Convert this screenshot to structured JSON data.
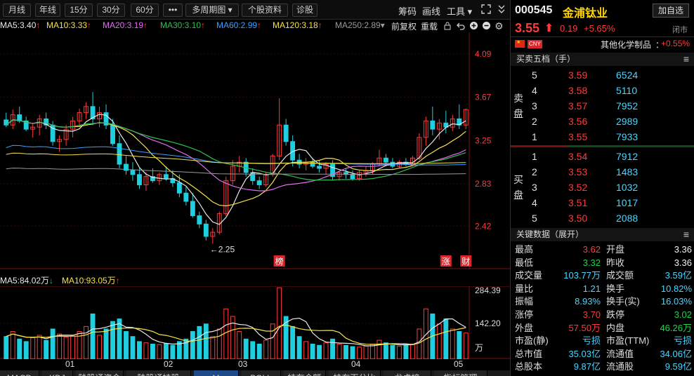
{
  "toolbar": {
    "periods": [
      "月线",
      "年线",
      "15分",
      "30分",
      "60分",
      "•••",
      "多周期图 ▾",
      "个股资料",
      "诊股"
    ],
    "right_links": [
      "筹码",
      "画线",
      "工具 ▾"
    ]
  },
  "ma_line": {
    "items": [
      {
        "text": "MA5:3.40",
        "arrow": "↑",
        "color": "#e8e8e8"
      },
      {
        "text": "MA10:3.33",
        "arrow": "↑",
        "color": "#f5e14b"
      },
      {
        "text": "MA20:3.19",
        "arrow": "↑",
        "color": "#e06cf2"
      },
      {
        "text": "MA30:3.10",
        "arrow": "↑",
        "color": "#2fbf4f"
      },
      {
        "text": "MA60:2.99",
        "arrow": "↑",
        "color": "#3aa0ff"
      },
      {
        "text": "MA120:3.18",
        "arrow": "↑",
        "color": "#f5e14b"
      },
      {
        "text": "MA250:2.89",
        "arrow": "▾",
        "color": "#9a9a9a"
      }
    ],
    "right": [
      "前复权",
      "重载"
    ]
  },
  "kchart": {
    "y_ticks": [
      "4.09",
      "3.67",
      "3.25",
      "2.83",
      "2.42"
    ],
    "low_label": "←2.25",
    "markers": [
      "榜",
      "涨",
      "财"
    ]
  },
  "volume": {
    "header": [
      {
        "text": "MA5:84.02万",
        "arrow": "↓",
        "color": "#e8e8e8"
      },
      {
        "text": "MA10:93.05万",
        "arrow": "↑",
        "color": "#f5e14b"
      }
    ],
    "y_ticks": [
      "284.39",
      "142.20",
      "万"
    ]
  },
  "xaxis": [
    "01",
    "02",
    "03",
    "04",
    "05"
  ],
  "bottom_tabs": [
    "MACD",
    "KDJ",
    "陆股通资金",
    "陆股通持股",
    "M",
    "BOLL",
    "持有金额",
    "持有百分比",
    "龙虎榜",
    "指标管理"
  ],
  "stock": {
    "code": "000545",
    "name": "金浦钛业",
    "add_button": "加自选",
    "price": "3.55",
    "change": "0.19",
    "change_pct": "+5.65%",
    "status": "闭市",
    "currency": "CNY",
    "sector": "其他化学制品",
    "sector_change": "+0.55%"
  },
  "order_book": {
    "title": "买卖五档（手）",
    "sell_label": [
      "卖",
      "盘"
    ],
    "buy_label": [
      "买",
      "盘"
    ],
    "sell": [
      {
        "level": "5",
        "price": "3.59",
        "vol": "6524"
      },
      {
        "level": "4",
        "price": "3.58",
        "vol": "5110"
      },
      {
        "level": "3",
        "price": "3.57",
        "vol": "7952"
      },
      {
        "level": "2",
        "price": "3.56",
        "vol": "2989"
      },
      {
        "level": "1",
        "price": "3.55",
        "vol": "7933"
      }
    ],
    "buy": [
      {
        "level": "1",
        "price": "3.54",
        "vol": "7912"
      },
      {
        "level": "2",
        "price": "3.53",
        "vol": "1483"
      },
      {
        "level": "3",
        "price": "3.52",
        "vol": "1032"
      },
      {
        "level": "4",
        "price": "3.51",
        "vol": "1017"
      },
      {
        "level": "5",
        "price": "3.50",
        "vol": "2088"
      }
    ]
  },
  "key_data": {
    "title": "关键数据（展开）",
    "rows": [
      {
        "l1": "最高",
        "v1": "3.62",
        "c1": "red",
        "l2": "开盘",
        "v2": "3.36",
        "c2": "white"
      },
      {
        "l1": "最低",
        "v1": "3.32",
        "c1": "green",
        "l2": "昨收",
        "v2": "3.36",
        "c2": "white"
      },
      {
        "l1": "成交量",
        "v1": "103.77万",
        "c1": "blue",
        "l2": "成交额",
        "v2": "3.59亿",
        "c2": "blue"
      },
      {
        "l1": "量比",
        "v1": "1.21",
        "c1": "blue",
        "l2": "换手",
        "v2": "10.82%",
        "c2": "blue"
      },
      {
        "l1": "振幅",
        "v1": "8.93%",
        "c1": "blue",
        "l2": "换手(实)",
        "v2": "16.03%",
        "c2": "blue"
      },
      {
        "l1": "涨停",
        "v1": "3.70",
        "c1": "red",
        "l2": "跌停",
        "v2": "3.02",
        "c2": "green"
      },
      {
        "l1": "外盘",
        "v1": "57.50万",
        "c1": "red",
        "l2": "内盘",
        "v2": "46.26万",
        "c2": "green"
      },
      {
        "l1": "市盈(静)",
        "v1": "亏损",
        "c1": "blue",
        "l2": "市盈(TTM)",
        "v2": "亏损",
        "c2": "blue"
      },
      {
        "l1": "总市值",
        "v1": "35.03亿",
        "c1": "blue",
        "l2": "流通值",
        "v2": "34.06亿",
        "c2": "blue"
      },
      {
        "l1": "总股本",
        "v1": "9.87亿",
        "c1": "blue",
        "l2": "流通股",
        "v2": "9.59亿",
        "c2": "blue"
      }
    ]
  },
  "colors": {
    "up": "#ff3b3b",
    "down": "#1fcfe0",
    "ma5": "#e8e8e8",
    "ma10": "#f5e14b",
    "ma20": "#e06cf2",
    "ma30": "#2fbf4f",
    "ma60": "#3aa0ff",
    "ma120": "#f5e14b",
    "ma250": "#9a9a9a"
  },
  "chart_data": {
    "type": "candlestick",
    "ylim": [
      2.0,
      4.3
    ],
    "candles": [
      [
        3.45,
        3.52,
        3.38,
        3.4
      ],
      [
        3.4,
        3.55,
        3.36,
        3.5
      ],
      [
        3.5,
        3.58,
        3.42,
        3.44
      ],
      [
        3.44,
        3.48,
        3.34,
        3.36
      ],
      [
        3.36,
        3.42,
        3.28,
        3.38
      ],
      [
        3.38,
        3.5,
        3.3,
        3.46
      ],
      [
        3.46,
        3.52,
        3.36,
        3.4
      ],
      [
        3.4,
        3.44,
        3.2,
        3.24
      ],
      [
        3.24,
        3.3,
        3.14,
        3.26
      ],
      [
        3.26,
        3.4,
        3.2,
        3.36
      ],
      [
        3.36,
        3.48,
        3.28,
        3.44
      ],
      [
        3.44,
        3.56,
        3.38,
        3.52
      ],
      [
        3.52,
        3.62,
        3.46,
        3.58
      ],
      [
        3.58,
        3.72,
        3.4,
        3.46
      ],
      [
        3.46,
        3.58,
        3.38,
        3.52
      ],
      [
        3.52,
        3.6,
        3.36,
        3.4
      ],
      [
        3.4,
        3.46,
        3.2,
        3.22
      ],
      [
        3.22,
        3.3,
        2.98,
        3.02
      ],
      [
        3.02,
        3.1,
        2.92,
        2.96
      ],
      [
        2.96,
        3.04,
        2.86,
        2.92
      ],
      [
        2.92,
        2.98,
        2.78,
        2.82
      ],
      [
        2.82,
        2.94,
        2.76,
        2.9
      ],
      [
        2.9,
        2.98,
        2.84,
        2.86
      ],
      [
        2.86,
        2.94,
        2.82,
        2.92
      ],
      [
        2.92,
        3.0,
        2.86,
        2.88
      ],
      [
        2.88,
        2.96,
        2.8,
        2.84
      ],
      [
        2.84,
        2.92,
        2.7,
        2.74
      ],
      [
        2.74,
        2.8,
        2.62,
        2.66
      ],
      [
        2.66,
        2.74,
        2.5,
        2.52
      ],
      [
        2.52,
        2.56,
        2.4,
        2.44
      ],
      [
        2.44,
        2.48,
        2.28,
        2.32
      ],
      [
        2.32,
        2.4,
        2.25,
        2.36
      ],
      [
        2.36,
        2.56,
        2.34,
        2.54
      ],
      [
        2.54,
        2.9,
        2.52,
        2.86
      ],
      [
        2.86,
        3.06,
        2.82,
        3.0
      ],
      [
        3.0,
        3.1,
        2.94,
        3.04
      ],
      [
        3.04,
        3.08,
        2.9,
        2.94
      ],
      [
        2.94,
        2.98,
        2.82,
        2.86
      ],
      [
        2.86,
        2.9,
        2.78,
        2.82
      ],
      [
        2.82,
        2.94,
        2.8,
        2.92
      ],
      [
        2.92,
        3.12,
        2.9,
        3.1
      ],
      [
        3.1,
        3.66,
        3.06,
        3.4
      ],
      [
        3.4,
        3.46,
        3.2,
        3.24
      ],
      [
        3.24,
        3.3,
        3.0,
        3.06
      ],
      [
        3.06,
        3.12,
        2.98,
        3.02
      ],
      [
        3.02,
        3.08,
        2.96,
        3.04
      ],
      [
        3.04,
        3.08,
        2.98,
        3.0
      ],
      [
        3.0,
        3.06,
        2.94,
        2.98
      ],
      [
        2.98,
        3.04,
        2.92,
        3.02
      ],
      [
        3.02,
        3.06,
        2.86,
        2.9
      ],
      [
        2.9,
        2.96,
        2.86,
        2.94
      ],
      [
        2.94,
        2.98,
        2.88,
        2.92
      ],
      [
        2.92,
        2.96,
        2.86,
        2.88
      ],
      [
        2.88,
        2.96,
        2.86,
        2.94
      ],
      [
        2.94,
        3.0,
        2.9,
        2.96
      ],
      [
        2.96,
        3.04,
        2.92,
        3.02
      ],
      [
        3.02,
        3.16,
        3.0,
        3.08
      ],
      [
        3.08,
        3.12,
        3.0,
        3.04
      ],
      [
        3.04,
        3.08,
        2.98,
        3.0
      ],
      [
        3.0,
        3.06,
        2.98,
        3.04
      ],
      [
        3.04,
        3.08,
        3.0,
        3.02
      ],
      [
        3.02,
        3.1,
        3.0,
        3.08
      ],
      [
        3.08,
        3.32,
        3.06,
        3.28
      ],
      [
        3.28,
        3.48,
        3.2,
        3.44
      ],
      [
        3.44,
        3.58,
        3.3,
        3.36
      ],
      [
        3.36,
        3.46,
        3.26,
        3.42
      ],
      [
        3.42,
        3.54,
        3.32,
        3.38
      ],
      [
        3.38,
        3.5,
        3.34,
        3.46
      ],
      [
        3.46,
        3.6,
        3.36,
        3.4
      ],
      [
        3.4,
        3.56,
        3.36,
        3.55
      ]
    ],
    "volumes": [
      90,
      110,
      80,
      70,
      85,
      95,
      75,
      120,
      100,
      88,
      92,
      110,
      130,
      180,
      95,
      120,
      150,
      160,
      110,
      90,
      70,
      65,
      60,
      58,
      62,
      55,
      70,
      80,
      110,
      130,
      140,
      90,
      120,
      200,
      170,
      110,
      80,
      70,
      60,
      75,
      140,
      284,
      170,
      130,
      90,
      70,
      60,
      55,
      65,
      80,
      60,
      55,
      50,
      48,
      52,
      60,
      75,
      65,
      55,
      52,
      58,
      60,
      120,
      200,
      180,
      140,
      160,
      120,
      110,
      104
    ]
  }
}
